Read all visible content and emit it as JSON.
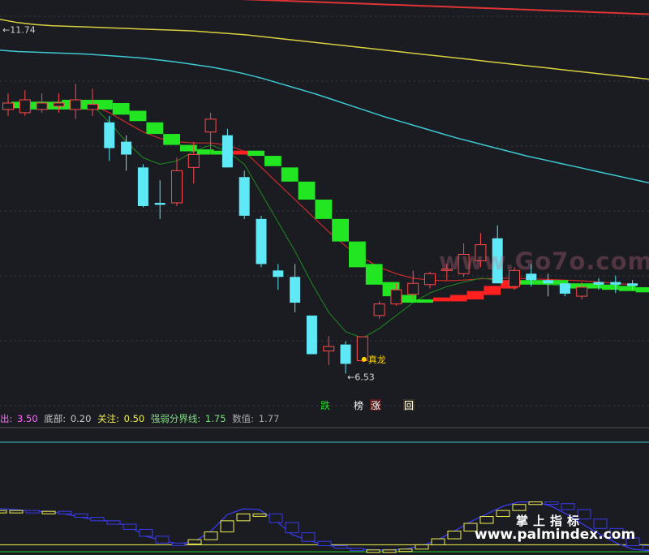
{
  "chart_data": {
    "type": "candlestick",
    "price_label": "11.74",
    "min_label": "6.53",
    "signal_label": "真龙",
    "y_range": [
      5.9,
      12.2
    ],
    "colors": {
      "up": "#ff4a4a",
      "down": "#5fe8f5",
      "ma_slow": "#e03434",
      "ma_yellow": "#d8d040",
      "ma_cyan": "#3ec8d0",
      "ribbon_green": "#22e622",
      "ribbon_red": "#ff2020",
      "osc_blue": "#3a3af0",
      "osc_yellow": "#f0f050"
    },
    "candles": [
      {
        "o": 10.5,
        "c": 10.6,
        "h": 10.75,
        "l": 10.4
      },
      {
        "o": 10.45,
        "c": 10.65,
        "h": 10.8,
        "l": 10.4
      },
      {
        "o": 10.5,
        "c": 10.6,
        "h": 10.75,
        "l": 10.45
      },
      {
        "o": 10.55,
        "c": 10.6,
        "h": 10.75,
        "l": 10.45
      },
      {
        "o": 10.5,
        "c": 10.65,
        "h": 10.9,
        "l": 10.35
      },
      {
        "o": 10.5,
        "c": 10.58,
        "h": 10.82,
        "l": 10.4
      },
      {
        "o": 10.3,
        "c": 9.9,
        "h": 10.4,
        "l": 9.7
      },
      {
        "o": 10.0,
        "c": 9.8,
        "h": 10.1,
        "l": 9.55
      },
      {
        "o": 9.6,
        "c": 9.0,
        "h": 9.65,
        "l": 8.98
      },
      {
        "o": 9.05,
        "c": 9.02,
        "h": 9.4,
        "l": 8.8
      },
      {
        "o": 9.05,
        "c": 9.55,
        "h": 9.75,
        "l": 9.0
      },
      {
        "o": 9.6,
        "c": 9.8,
        "h": 10.0,
        "l": 9.35
      },
      {
        "o": 10.15,
        "c": 10.35,
        "h": 10.45,
        "l": 9.8
      },
      {
        "o": 10.1,
        "c": 9.6,
        "h": 10.2,
        "l": 9.6
      },
      {
        "o": 9.45,
        "c": 8.85,
        "h": 9.55,
        "l": 8.8
      },
      {
        "o": 8.8,
        "c": 8.1,
        "h": 8.85,
        "l": 8.05
      },
      {
        "o": 8.0,
        "c": 7.9,
        "h": 8.1,
        "l": 7.7
      },
      {
        "o": 7.9,
        "c": 7.5,
        "h": 8.1,
        "l": 7.35
      },
      {
        "o": 7.3,
        "c": 6.7,
        "h": 7.3,
        "l": 6.7
      },
      {
        "o": 6.75,
        "c": 6.82,
        "h": 6.98,
        "l": 6.53
      },
      {
        "o": 6.85,
        "c": 6.55,
        "h": 6.9,
        "l": 6.4
      },
      {
        "o": 6.6,
        "c": 6.97,
        "h": 6.97,
        "l": 6.58
      },
      {
        "o": 7.3,
        "c": 7.48,
        "h": 7.52,
        "l": 7.25
      },
      {
        "o": 7.48,
        "c": 7.7,
        "h": 7.8,
        "l": 7.45
      },
      {
        "o": 7.63,
        "c": 7.8,
        "h": 8.0,
        "l": 7.55
      },
      {
        "o": 7.78,
        "c": 7.95,
        "h": 7.98,
        "l": 7.72
      },
      {
        "o": 8.0,
        "c": 8.02,
        "h": 8.1,
        "l": 7.85
      },
      {
        "o": 7.95,
        "c": 8.25,
        "h": 8.42,
        "l": 7.9
      },
      {
        "o": 8.15,
        "c": 8.4,
        "h": 8.58,
        "l": 8.05
      },
      {
        "o": 8.5,
        "c": 7.8,
        "h": 8.7,
        "l": 7.8
      },
      {
        "o": 7.75,
        "c": 8.0,
        "h": 8.05,
        "l": 7.7
      },
      {
        "o": 7.95,
        "c": 7.85,
        "h": 8.1,
        "l": 7.75
      },
      {
        "o": 7.85,
        "c": 7.8,
        "h": 7.95,
        "l": 7.6
      },
      {
        "o": 7.8,
        "c": 7.64,
        "h": 7.8,
        "l": 7.6
      },
      {
        "o": 7.6,
        "c": 7.74,
        "h": 7.82,
        "l": 7.55
      },
      {
        "o": 7.82,
        "c": 7.78,
        "h": 7.88,
        "l": 7.7
      },
      {
        "o": 7.82,
        "c": 7.78,
        "h": 7.92,
        "l": 7.65
      },
      {
        "o": 7.8,
        "c": 7.76,
        "h": 7.85,
        "l": 7.7
      }
    ],
    "ribbon": [
      {
        "top": 10.62,
        "bottom": 10.52,
        "color": "green"
      },
      {
        "top": 10.62,
        "bottom": 10.5,
        "color": "green"
      },
      {
        "top": 10.62,
        "bottom": 10.5,
        "color": "green"
      },
      {
        "top": 10.65,
        "bottom": 10.5,
        "color": "green"
      },
      {
        "top": 10.65,
        "bottom": 10.5,
        "color": "green"
      },
      {
        "top": 10.65,
        "bottom": 10.5,
        "color": "green"
      },
      {
        "top": 10.6,
        "bottom": 10.42,
        "color": "green"
      },
      {
        "top": 10.48,
        "bottom": 10.32,
        "color": "green"
      },
      {
        "top": 10.3,
        "bottom": 10.12,
        "color": "green"
      },
      {
        "top": 10.12,
        "bottom": 9.95,
        "color": "green"
      },
      {
        "top": 9.95,
        "bottom": 9.85,
        "color": "green"
      },
      {
        "top": 9.88,
        "bottom": 9.8,
        "color": "green"
      },
      {
        "top": 9.86,
        "bottom": 9.8,
        "color": "green"
      },
      {
        "top": 9.86,
        "bottom": 9.8,
        "color": "red"
      },
      {
        "top": 9.86,
        "bottom": 9.78,
        "color": "green"
      },
      {
        "top": 9.78,
        "bottom": 9.62,
        "color": "green"
      },
      {
        "top": 9.6,
        "bottom": 9.38,
        "color": "green"
      },
      {
        "top": 9.38,
        "bottom": 9.1,
        "color": "green"
      },
      {
        "top": 9.1,
        "bottom": 8.8,
        "color": "green"
      },
      {
        "top": 8.8,
        "bottom": 8.45,
        "color": "green"
      },
      {
        "top": 8.45,
        "bottom": 8.05,
        "color": "green"
      },
      {
        "top": 8.1,
        "bottom": 7.78,
        "color": "green"
      },
      {
        "top": 7.82,
        "bottom": 7.6,
        "color": "green"
      },
      {
        "top": 7.62,
        "bottom": 7.5,
        "color": "green"
      },
      {
        "top": 7.55,
        "bottom": 7.5,
        "color": "green"
      },
      {
        "top": 7.58,
        "bottom": 7.52,
        "color": "red"
      },
      {
        "top": 7.62,
        "bottom": 7.52,
        "color": "red"
      },
      {
        "top": 7.68,
        "bottom": 7.55,
        "color": "red"
      },
      {
        "top": 7.76,
        "bottom": 7.62,
        "color": "red"
      },
      {
        "top": 7.85,
        "bottom": 7.72,
        "color": "red"
      },
      {
        "top": 7.85,
        "bottom": 7.78,
        "color": "green"
      },
      {
        "top": 7.85,
        "bottom": 7.78,
        "color": "green"
      },
      {
        "top": 7.85,
        "bottom": 7.78,
        "color": "green"
      },
      {
        "top": 7.8,
        "bottom": 7.72,
        "color": "green"
      },
      {
        "top": 7.8,
        "bottom": 7.72,
        "color": "green"
      },
      {
        "top": 7.78,
        "bottom": 7.7,
        "color": "green"
      },
      {
        "top": 7.76,
        "bottom": 7.68,
        "color": "green"
      },
      {
        "top": 7.74,
        "bottom": 7.66,
        "color": "green"
      }
    ],
    "ma_lines": {
      "yellow": [
        11.9,
        11.85,
        11.82,
        11.8,
        11.79,
        11.78,
        11.77,
        11.76,
        11.75,
        11.74,
        11.73,
        11.72,
        11.7,
        11.68,
        11.66,
        11.63,
        11.6,
        11.57,
        11.54,
        11.51,
        11.48,
        11.45,
        11.42,
        11.39,
        11.36,
        11.33,
        11.3,
        11.27,
        11.24,
        11.21,
        11.18,
        11.15,
        11.12,
        11.09,
        11.06,
        11.03,
        11.0,
        10.97
      ],
      "cyan": [
        11.42,
        11.4,
        11.39,
        11.38,
        11.37,
        11.36,
        11.34,
        11.32,
        11.3,
        11.27,
        11.24,
        11.2,
        11.16,
        11.11,
        11.05,
        10.98,
        10.9,
        10.82,
        10.74,
        10.65,
        10.56,
        10.47,
        10.38,
        10.3,
        10.22,
        10.14,
        10.06,
        9.99,
        9.92,
        9.85,
        9.78,
        9.72,
        9.66,
        9.6,
        9.54,
        9.48,
        9.42,
        9.36
      ],
      "red_slow": [
        12.35,
        12.34,
        12.33,
        12.32,
        12.31,
        12.3,
        12.29,
        12.28,
        12.27,
        12.26,
        12.25,
        12.24,
        12.23,
        12.22,
        12.21,
        12.2,
        12.19,
        12.18,
        12.17,
        12.16,
        12.15,
        12.14,
        12.13,
        12.12,
        12.11,
        12.1,
        12.09,
        12.08,
        12.07,
        12.06,
        12.05,
        12.04,
        12.03,
        12.02,
        12.01,
        12.0,
        11.99,
        11.98
      ],
      "red_mid": [
        10.55,
        10.55,
        10.55,
        10.56,
        10.57,
        10.57,
        10.45,
        10.3,
        10.15,
        10.05,
        10.0,
        9.98,
        9.98,
        9.95,
        9.85,
        9.6,
        9.35,
        9.1,
        8.85,
        8.6,
        8.38,
        8.2,
        8.05,
        7.95,
        7.88,
        7.85,
        7.84,
        7.85,
        7.87,
        7.88,
        7.88,
        7.87,
        7.86,
        7.85,
        7.84,
        7.82,
        7.8,
        7.78
      ],
      "green_fast": [
        10.55,
        10.55,
        10.56,
        10.57,
        10.58,
        10.57,
        10.3,
        10.0,
        9.75,
        9.65,
        9.7,
        9.85,
        9.95,
        9.85,
        9.65,
        9.2,
        8.75,
        8.3,
        7.8,
        7.35,
        7.05,
        6.95,
        7.1,
        7.3,
        7.5,
        7.65,
        7.75,
        7.82,
        7.88,
        7.85,
        7.83,
        7.8,
        7.78,
        7.76,
        7.74,
        7.74,
        7.73,
        7.72
      ]
    },
    "markers": [
      {
        "label": "跌",
        "index": 19,
        "color": "#22dd22"
      },
      {
        "label": "榜",
        "index": 21,
        "color": "#ffffff"
      },
      {
        "label": "涨",
        "index": 22,
        "color": "#ffffff"
      },
      {
        "label": "回",
        "index": 24,
        "color": "#ffffff"
      }
    ],
    "indicator": {
      "items": [
        {
          "label": "出:",
          "value": "3.50",
          "color": "#ff66ff"
        },
        {
          "label": "底部:",
          "value": "0.20",
          "color": "#c8c8c8"
        },
        {
          "label": "关注:",
          "value": "0.50",
          "color": "#f0f050"
        },
        {
          "label": "强弱分界线:",
          "value": "1.75",
          "color": "#7fdf7f"
        },
        {
          "label": "数值:",
          "value": "1.77",
          "color": "#aaaaaa"
        }
      ],
      "y_range": [
        0,
        3.5
      ],
      "line_value": 0.5,
      "blue": [
        2.6,
        2.55,
        2.45,
        2.45,
        2.3,
        2.1,
        1.95,
        1.85,
        1.55,
        1.0,
        0.75,
        0.55,
        0.7,
        1.3,
        2.25,
        2.6,
        2.55,
        1.9,
        1.1,
        0.75,
        0.5,
        0.35,
        0.25,
        0.2,
        0.2,
        0.25,
        0.45,
        0.8,
        1.3,
        1.85,
        2.3,
        2.75,
        3.0,
        3.0,
        2.75,
        2.25,
        1.65,
        1.1,
        0.6,
        0.25,
        0.15
      ],
      "steps": [
        2.5,
        2.5,
        2.45,
        2.45,
        2.3,
        2.1,
        1.9,
        1.7,
        1.4,
        1.0,
        0.6,
        0.55,
        0.8,
        1.25,
        1.9,
        2.3,
        2.3,
        1.8,
        1.2,
        0.7,
        0.45,
        0.3,
        0.2,
        0.2,
        0.2,
        0.25,
        0.5,
        0.85,
        1.3,
        1.75,
        2.15,
        2.5,
        2.85,
        3.0,
        2.9,
        2.55,
        2.0,
        1.45,
        0.9,
        0.45,
        0.2
      ]
    },
    "watermarks": [
      "www.Go7o.com",
      "掌上指标",
      "www.palmindex.com"
    ]
  }
}
